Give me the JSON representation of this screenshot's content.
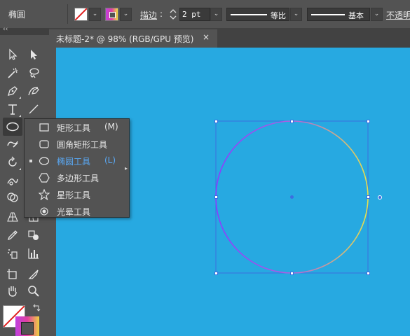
{
  "control_bar": {
    "selection_label": "椭圆",
    "stroke_label": "描边",
    "stroke_colon": ":",
    "stroke_weight": "2 pt",
    "profile_label": "等比",
    "brush_label": "基本",
    "opacity_label": "不透明"
  },
  "panel_collapse": "‹‹",
  "document_tab": {
    "title": "未标题-2* @ 98% (RGB/GPU 预览)",
    "close": "×"
  },
  "flyout": {
    "items": [
      {
        "label": "矩形工具",
        "shortcut": "(M)",
        "icon": "rectangle-icon",
        "active": false
      },
      {
        "label": "圆角矩形工具",
        "shortcut": "",
        "icon": "rounded-rectangle-icon",
        "active": false
      },
      {
        "label": "椭圆工具",
        "shortcut": "(L)",
        "icon": "ellipse-icon",
        "active": true
      },
      {
        "label": "多边形工具",
        "shortcut": "",
        "icon": "polygon-icon",
        "active": false
      },
      {
        "label": "星形工具",
        "shortcut": "",
        "icon": "star-icon",
        "active": false
      },
      {
        "label": "光晕工具",
        "shortcut": "",
        "icon": "flare-icon",
        "active": false
      }
    ]
  },
  "colors": {
    "canvas": "#27a9e1",
    "panel": "#535353",
    "selection": "#3b6ee0",
    "accent_text": "#5aa9f5"
  }
}
